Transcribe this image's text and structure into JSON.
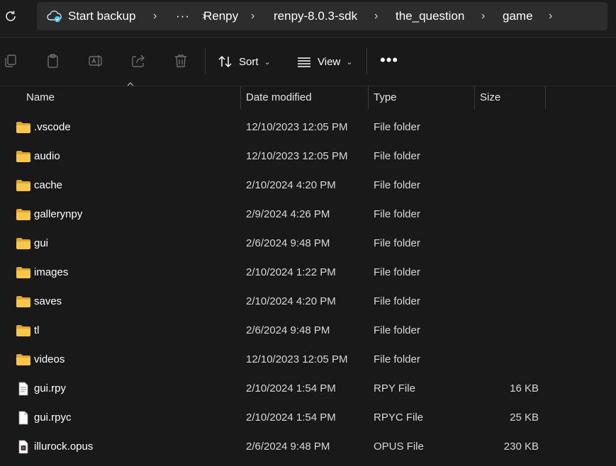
{
  "address_bar": {
    "breadcrumbs": [
      "Start backup",
      "···",
      "Renpy",
      "renpy-8.0.3-sdk",
      "the_question",
      "game"
    ],
    "separator": "›",
    "backup_accent": "#4cc2ff"
  },
  "toolbar": {
    "icons": [
      "copy-icon",
      "paste-icon",
      "rename-icon",
      "share-icon",
      "delete-icon"
    ],
    "sort_label": "Sort",
    "view_label": "View",
    "more_label": "•••"
  },
  "columns": {
    "name": "Name",
    "date_modified": "Date modified",
    "type": "Type",
    "size": "Size"
  },
  "files": [
    {
      "name": ".vscode",
      "date": "12/10/2023 12:05 PM",
      "type": "File folder",
      "size": "",
      "icon": "folder-icon"
    },
    {
      "name": "audio",
      "date": "12/10/2023 12:05 PM",
      "type": "File folder",
      "size": "",
      "icon": "folder-icon"
    },
    {
      "name": "cache",
      "date": "2/10/2024 4:20 PM",
      "type": "File folder",
      "size": "",
      "icon": "folder-icon"
    },
    {
      "name": "gallerynpy",
      "date": "2/9/2024 4:26 PM",
      "type": "File folder",
      "size": "",
      "icon": "folder-icon"
    },
    {
      "name": "gui",
      "date": "2/6/2024 9:48 PM",
      "type": "File folder",
      "size": "",
      "icon": "folder-icon"
    },
    {
      "name": "images",
      "date": "2/10/2024 1:22 PM",
      "type": "File folder",
      "size": "",
      "icon": "folder-icon"
    },
    {
      "name": "saves",
      "date": "2/10/2024 4:20 PM",
      "type": "File folder",
      "size": "",
      "icon": "folder-icon"
    },
    {
      "name": "tl",
      "date": "2/6/2024 9:48 PM",
      "type": "File folder",
      "size": "",
      "icon": "folder-icon"
    },
    {
      "name": "videos",
      "date": "12/10/2023 12:05 PM",
      "type": "File folder",
      "size": "",
      "icon": "folder-icon"
    },
    {
      "name": "gui.rpy",
      "date": "2/10/2024 1:54 PM",
      "type": "RPY File",
      "size": "16 KB",
      "icon": "text-file-icon"
    },
    {
      "name": "gui.rpyc",
      "date": "2/10/2024 1:54 PM",
      "type": "RPYC File",
      "size": "25 KB",
      "icon": "blank-file-icon"
    },
    {
      "name": "illurock.opus",
      "date": "2/6/2024 9:48 PM",
      "type": "OPUS File",
      "size": "230 KB",
      "icon": "audio-file-icon"
    }
  ],
  "colors": {
    "folder": "#f8c74a",
    "folder_dark": "#e0a82c",
    "background": "#191919",
    "address_bg": "#2d2d2d"
  }
}
